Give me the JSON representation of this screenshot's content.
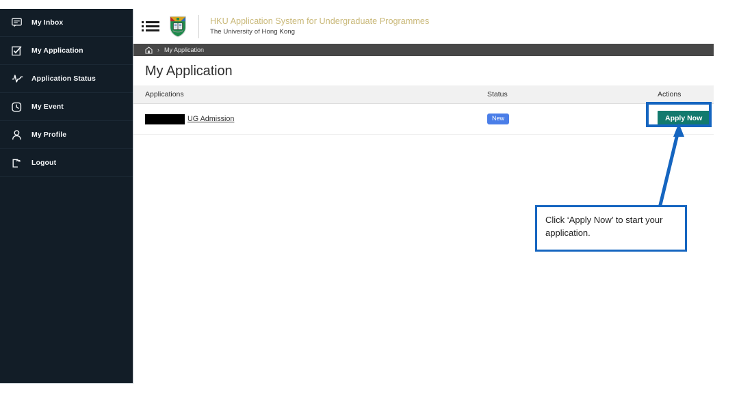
{
  "sidebar": {
    "items": [
      {
        "label": "My Inbox",
        "icon": "inbox-message-icon"
      },
      {
        "label": "My Application",
        "icon": "checklist-icon"
      },
      {
        "label": "Application Status",
        "icon": "pulse-activity-icon"
      },
      {
        "label": "My Event",
        "icon": "clock-icon"
      },
      {
        "label": "My Profile",
        "icon": "person-icon"
      },
      {
        "label": "Logout",
        "icon": "logout-arrow-icon"
      }
    ]
  },
  "header": {
    "menu_icon": "hamburger-list-icon",
    "logo_icon": "hku-crest-icon",
    "title": "HKU Application System for Undergraduate Programmes",
    "subtitle": "The University of Hong Kong",
    "title_color": "#c9b878"
  },
  "breadcrumb": {
    "home_icon": "home-icon",
    "separator": "›",
    "current": "My Application"
  },
  "main": {
    "page_title": "My Application",
    "table": {
      "columns": [
        "Applications",
        "Status",
        "Actions"
      ],
      "rows": [
        {
          "application_name": "UG Admission",
          "application_redacted": true,
          "status": "New",
          "status_color": "#4a7ee8",
          "action_label": "Apply Now",
          "action_color": "#127a6e"
        }
      ]
    }
  },
  "annotation": {
    "callout_text": "Click ‘Apply Now’ to start your application.",
    "accent_color": "#1565c0",
    "highlight_target": "Apply Now"
  }
}
